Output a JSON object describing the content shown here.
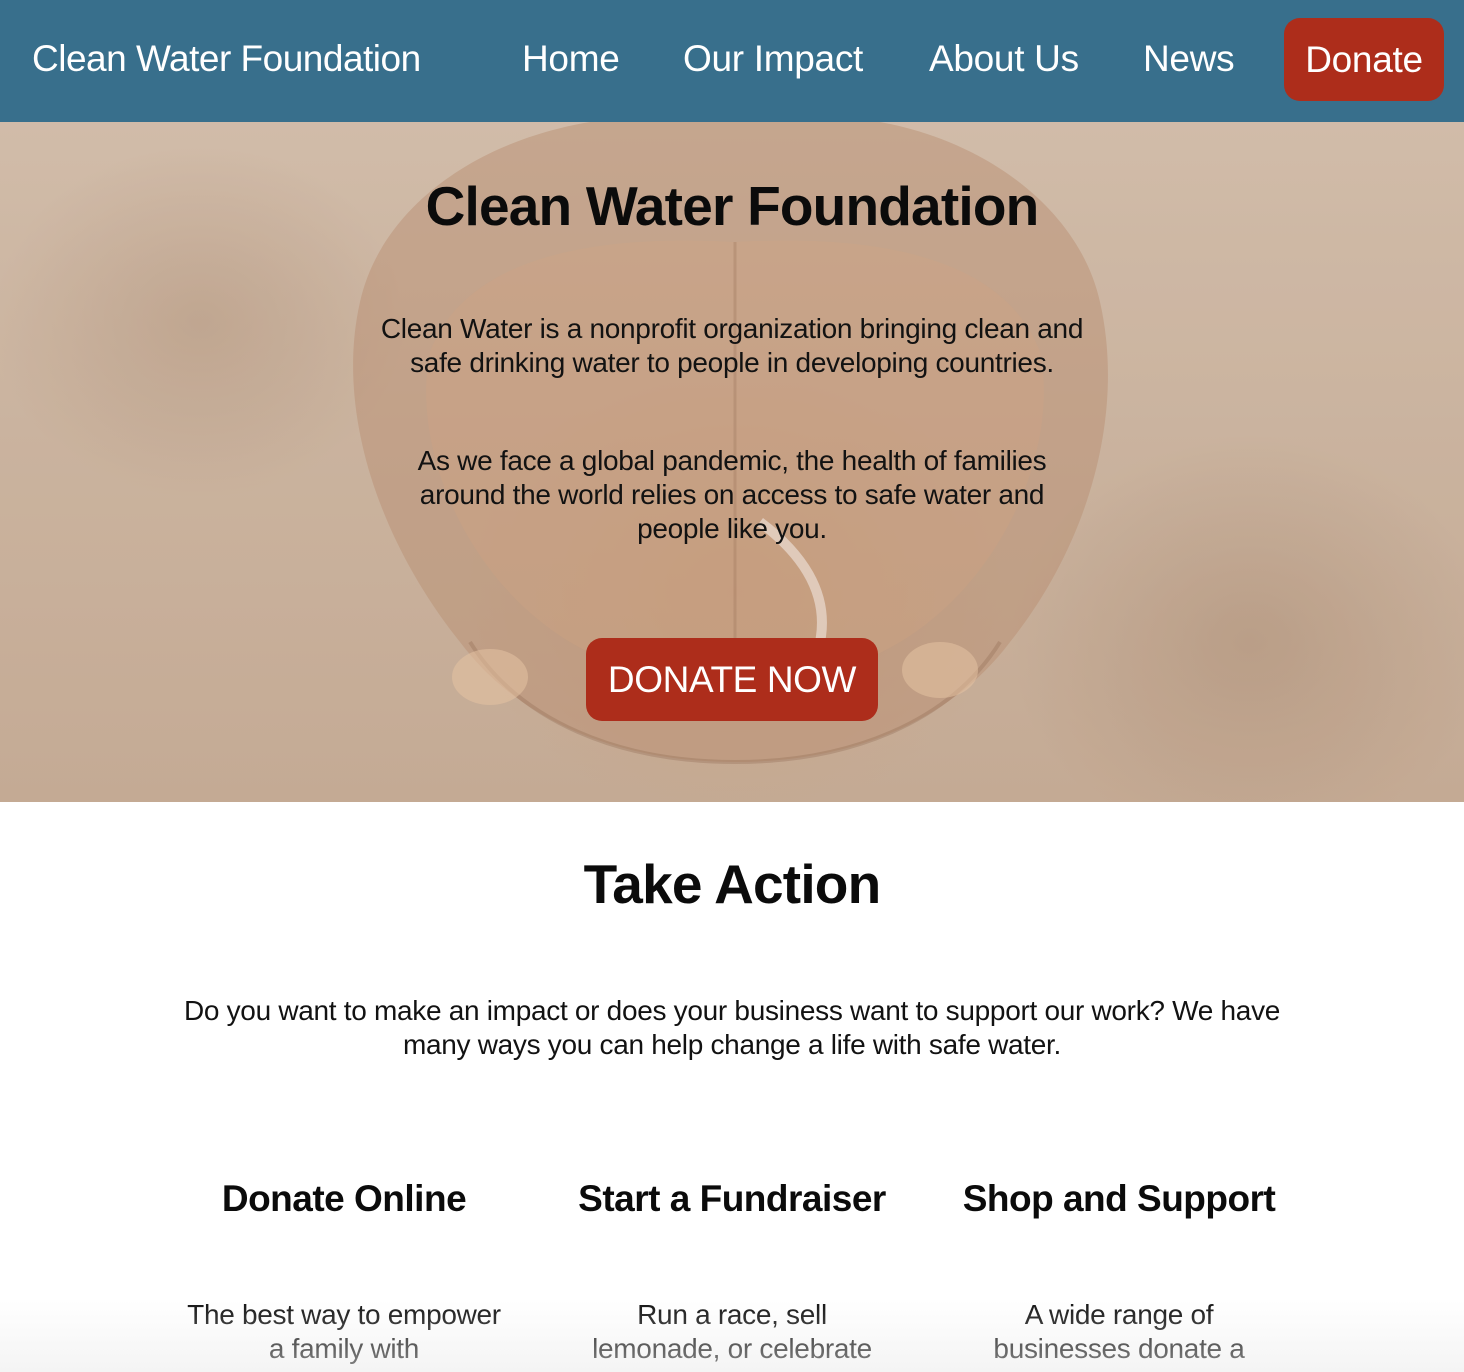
{
  "nav": {
    "brand": "Clean Water Foundation",
    "links": [
      "Home",
      "Our Impact",
      "About Us",
      "News"
    ],
    "donate_label": "Donate"
  },
  "hero": {
    "title": "Clean Water Foundation",
    "paragraph_1": "Clean Water is a nonprofit organization bringing clean and safe drinking water to people in developing countries.",
    "paragraph_2": "As we face a global pandemic, the health of families around the world relies on access to safe water and people like you.",
    "cta_label": "DONATE NOW"
  },
  "take_action": {
    "title": "Take Action",
    "intro": "Do you want to make an impact or does your business want to support our work? We have many ways you can help change a life with safe water.",
    "cards": [
      {
        "title": "Donate Online",
        "text": "The best way to empower a family with"
      },
      {
        "title": "Start a Fundraiser",
        "text": "Run a race, sell lemonade, or celebrate"
      },
      {
        "title": "Shop and Support",
        "text": "A wide range of businesses donate a"
      }
    ]
  },
  "colors": {
    "nav_bg": "#386f8c",
    "accent": "#ad2d1b",
    "text": "#111111"
  }
}
